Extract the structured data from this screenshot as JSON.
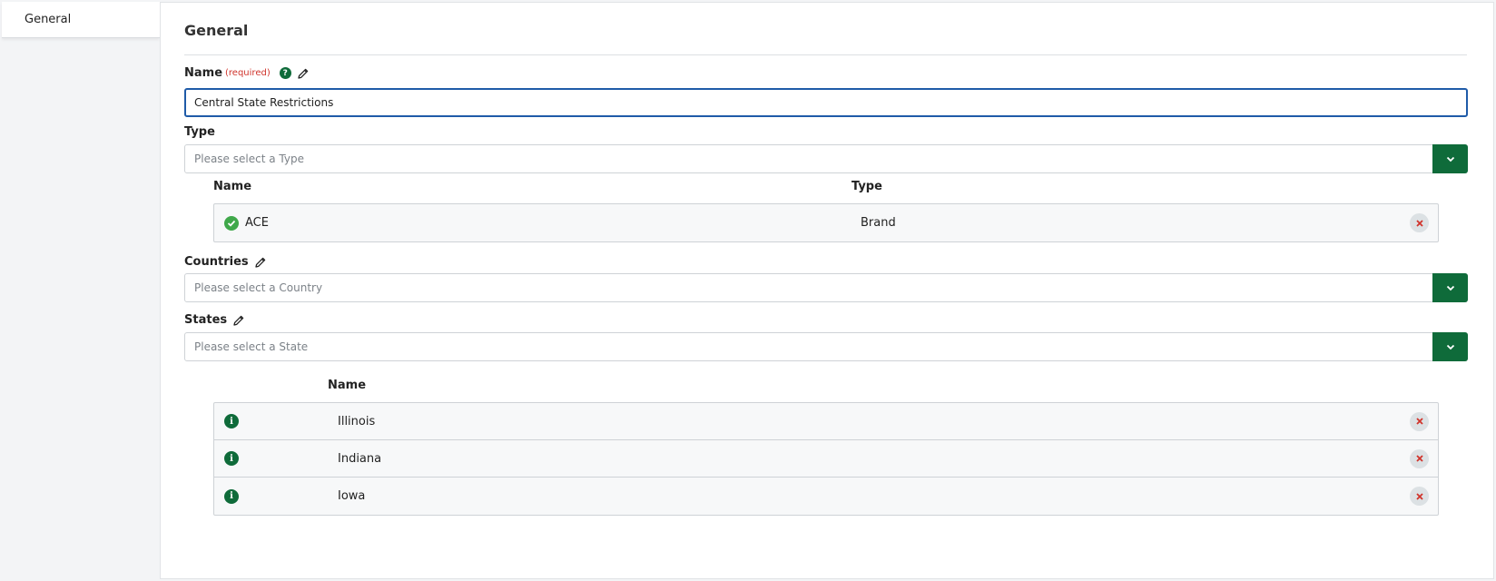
{
  "sidebar": {
    "tab_label": "General"
  },
  "section": {
    "title": "General"
  },
  "name_field": {
    "label": "Name",
    "required_text": "(required)",
    "help_icon": "question-icon",
    "value": "Central State Restrictions"
  },
  "type_field": {
    "label": "Type",
    "placeholder": "Please select a Type",
    "table": {
      "headers": [
        "Name",
        "Type"
      ],
      "rows": [
        {
          "name": "ACE",
          "type": "Brand",
          "status_icon": "check-circle-icon"
        }
      ]
    }
  },
  "countries_field": {
    "label": "Countries",
    "placeholder": "Please select a Country"
  },
  "states_field": {
    "label": "States",
    "placeholder": "Please select a State",
    "table": {
      "headers": [
        "Name"
      ],
      "rows": [
        {
          "name": "Illinois",
          "status_icon": "info-icon"
        },
        {
          "name": "Indiana",
          "status_icon": "info-icon"
        },
        {
          "name": "Iowa",
          "status_icon": "info-icon"
        }
      ]
    }
  },
  "colors": {
    "accent": "#0f6b3a",
    "focus": "#1f5ba8",
    "required": "#d0342c",
    "remove": "#d0342c"
  }
}
